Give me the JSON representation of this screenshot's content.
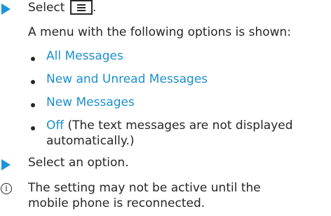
{
  "step1": {
    "prefix": "Select",
    "suffix": ".",
    "icon": "menu-list-icon"
  },
  "intro": "A menu with the following options is shown:",
  "options": [
    {
      "label": "All Messages",
      "rest": ""
    },
    {
      "label": "New and Unread Messages",
      "rest": ""
    },
    {
      "label": "New Messages",
      "rest": ""
    },
    {
      "label": "Off",
      "rest": " (The text messages are not displayed",
      "rest2": "automatically.)"
    }
  ],
  "step2": "Select an option.",
  "note": {
    "line1": "The setting may not be active until the",
    "line2": "mobile phone is reconnected",
    "line2_end": "."
  },
  "colors": {
    "accent": "#1b95d6",
    "link": "#1b8fce",
    "text": "#262626"
  }
}
